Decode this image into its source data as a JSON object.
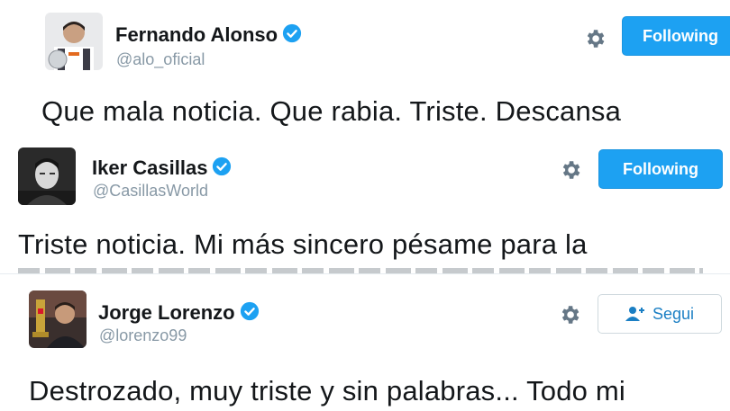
{
  "tweets": [
    {
      "name": "Fernando Alonso",
      "handle": "@alo_oficial",
      "button": "Following",
      "text": "Que mala noticia. Que rabia. Triste. Descansa"
    },
    {
      "name": "Iker Casillas",
      "handle": "@CasillasWorld",
      "button": "Following",
      "text": "Triste noticia. Mi más sincero pésame para la"
    },
    {
      "name": "Jorge Lorenzo",
      "handle": "@lorenzo99",
      "button": "Segui",
      "text": "Destrozado, muy triste y sin palabras... Todo mi"
    }
  ],
  "icons": {
    "verified": "verified-badge-icon",
    "settings": "gear-icon",
    "follow": "add-user-icon"
  },
  "colors": {
    "accent": "#1da1f2",
    "handle": "#8899a6",
    "text": "#14171a"
  }
}
